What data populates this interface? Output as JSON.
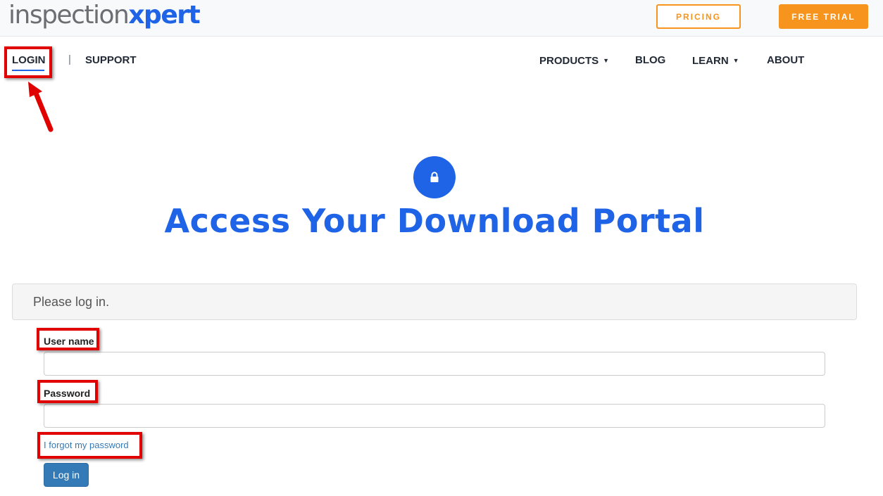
{
  "header": {
    "logo_part1": "inspection",
    "logo_part2": "xpert",
    "pricing_label": "PRICING",
    "free_trial_label": "FREE TRIAL"
  },
  "nav": {
    "login": "LOGIN",
    "separator": "|",
    "support": "SUPPORT",
    "products": "PRODUCTS",
    "blog": "BLOG",
    "learn": "LEARN",
    "about": "ABOUT",
    "dropdown_caret": "▼"
  },
  "hero": {
    "icon": "lock-icon",
    "title": "Access Your Download Portal"
  },
  "form": {
    "panel_heading": "Please log in.",
    "username_label": "User name",
    "username_value": "",
    "password_label": "Password",
    "password_value": "",
    "forgot_link": "I forgot my password",
    "submit_label": "Log in"
  },
  "colors": {
    "brand_blue": "#1f63e6",
    "accent_orange": "#f7941d",
    "annotation_red": "#e00000",
    "link_blue": "#337ab7"
  }
}
